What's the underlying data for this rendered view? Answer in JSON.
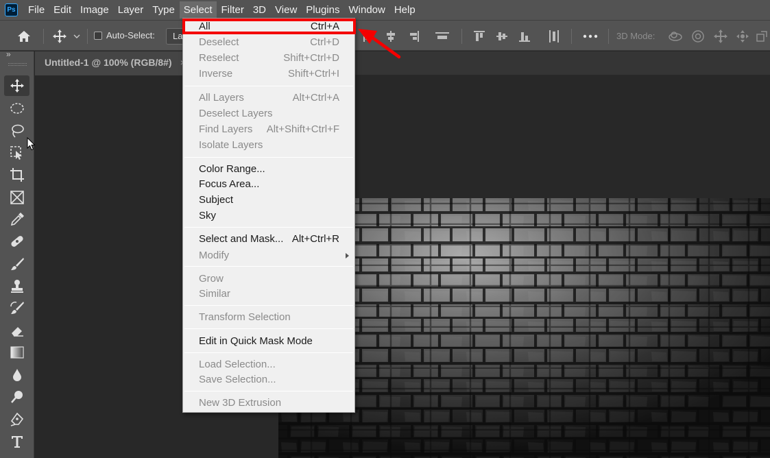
{
  "app": {
    "logo_text": "Ps"
  },
  "menubar": {
    "items": [
      "File",
      "Edit",
      "Image",
      "Layer",
      "Type",
      "Select",
      "Filter",
      "3D",
      "View",
      "Plugins",
      "Window",
      "Help"
    ],
    "active": "Select"
  },
  "options": {
    "auto_select_label": "Auto-Select:",
    "auto_select_checked": false,
    "layer_select_value": "La",
    "mode_3d_label": "3D Mode:"
  },
  "document": {
    "tab_title": "Untitled-1 @ 100% (RGB/8#)",
    "tab_close": "×"
  },
  "panel": {
    "collapse_glyph": "»"
  },
  "select_menu": {
    "groups": [
      [
        {
          "label": "All",
          "shortcut": "Ctrl+A",
          "enabled": true,
          "highlighted": true
        },
        {
          "label": "Deselect",
          "shortcut": "Ctrl+D",
          "enabled": false
        },
        {
          "label": "Reselect",
          "shortcut": "Shift+Ctrl+D",
          "enabled": false
        },
        {
          "label": "Inverse",
          "shortcut": "Shift+Ctrl+I",
          "enabled": false
        }
      ],
      [
        {
          "label": "All Layers",
          "shortcut": "Alt+Ctrl+A",
          "enabled": false
        },
        {
          "label": "Deselect Layers",
          "shortcut": "",
          "enabled": false
        },
        {
          "label": "Find Layers",
          "shortcut": "Alt+Shift+Ctrl+F",
          "enabled": false
        },
        {
          "label": "Isolate Layers",
          "shortcut": "",
          "enabled": false
        }
      ],
      [
        {
          "label": "Color Range...",
          "shortcut": "",
          "enabled": true
        },
        {
          "label": "Focus Area...",
          "shortcut": "",
          "enabled": true
        },
        {
          "label": "Subject",
          "shortcut": "",
          "enabled": true
        },
        {
          "label": "Sky",
          "shortcut": "",
          "enabled": true
        }
      ],
      [
        {
          "label": "Select and Mask...",
          "shortcut": "Alt+Ctrl+R",
          "enabled": true
        },
        {
          "label": "Modify",
          "shortcut": "",
          "enabled": false,
          "submenu": true
        }
      ],
      [
        {
          "label": "Grow",
          "shortcut": "",
          "enabled": false
        },
        {
          "label": "Similar",
          "shortcut": "",
          "enabled": false
        }
      ],
      [
        {
          "label": "Transform Selection",
          "shortcut": "",
          "enabled": false
        }
      ],
      [
        {
          "label": "Edit in Quick Mask Mode",
          "shortcut": "",
          "enabled": true
        }
      ],
      [
        {
          "label": "Load Selection...",
          "shortcut": "",
          "enabled": false
        },
        {
          "label": "Save Selection...",
          "shortcut": "",
          "enabled": false
        }
      ],
      [
        {
          "label": "New 3D Extrusion",
          "shortcut": "",
          "enabled": false
        }
      ]
    ]
  },
  "tools": [
    "move-tool",
    "marquee-tool",
    "lasso-tool",
    "object-selection-tool",
    "crop-tool",
    "frame-tool",
    "eyedropper-tool",
    "healing-brush-tool",
    "brush-tool",
    "clone-stamp-tool",
    "history-brush-tool",
    "eraser-tool",
    "gradient-tool",
    "blur-tool",
    "dodge-tool",
    "pen-tool",
    "type-tool"
  ],
  "colors": {
    "chrome": "#535353",
    "workspace": "#282828",
    "menu_bg": "#f0f0f0",
    "annotation_red": "#f40000",
    "brand_blue": "#31a8ff"
  }
}
